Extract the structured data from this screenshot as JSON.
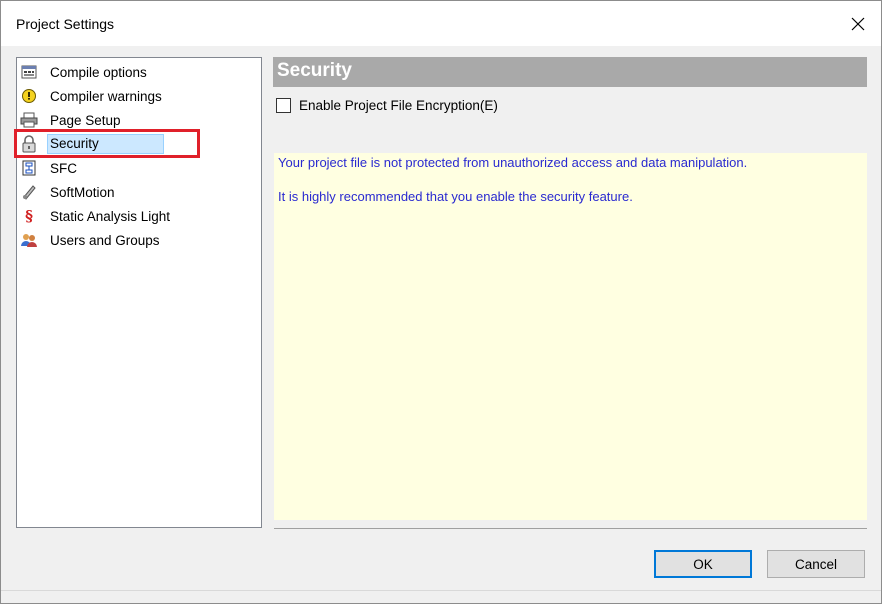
{
  "window": {
    "title": "Project Settings"
  },
  "sidebar": {
    "items": [
      {
        "label": "Compile options",
        "icon": "compile-options-icon"
      },
      {
        "label": "Compiler warnings",
        "icon": "warning-icon"
      },
      {
        "label": "Page Setup",
        "icon": "printer-icon"
      },
      {
        "label": "Security",
        "icon": "lock-icon",
        "selected": true
      },
      {
        "label": "SFC",
        "icon": "sfc-icon"
      },
      {
        "label": "SoftMotion",
        "icon": "softmotion-icon"
      },
      {
        "label": "Static Analysis Light",
        "icon": "section-sign-icon"
      },
      {
        "label": "Users and Groups",
        "icon": "users-icon"
      }
    ]
  },
  "security": {
    "heading": "Security",
    "encryption_checkbox": {
      "label": "Enable Project File Encryption(E)",
      "checked": false
    },
    "info_lines": [
      "Your project file is not protected from unauthorized access and data manipulation.",
      "It is highly recommended that you enable the security feature."
    ]
  },
  "buttons": {
    "ok": "OK",
    "cancel": "Cancel"
  },
  "colors": {
    "selection": "#cce8ff",
    "highlight_border": "#e0202a",
    "info_background": "#ffffe1",
    "info_text": "#2a2ad0",
    "header_background": "#a9a9a9"
  }
}
